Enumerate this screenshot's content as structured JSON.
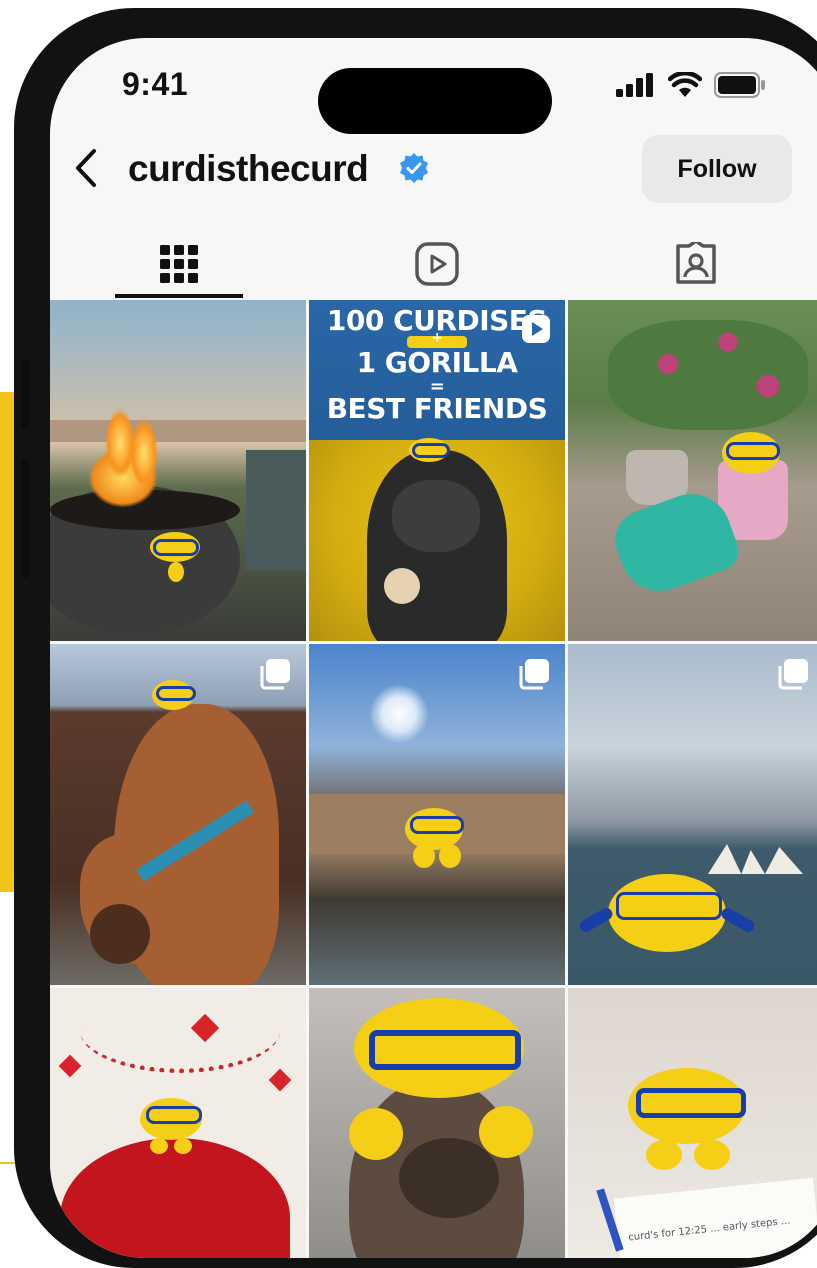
{
  "status_bar": {
    "time": "9:41"
  },
  "profile": {
    "username": "curdisthecurd",
    "verified": true
  },
  "header": {
    "follow_label": "Follow"
  },
  "tabs": [
    {
      "name": "grid-icon",
      "active": true
    },
    {
      "name": "reels-icon",
      "active": false
    },
    {
      "name": "tagged-icon",
      "active": false
    }
  ],
  "posts": [
    {
      "subject": "fire pit at sunset",
      "type": "photo"
    },
    {
      "subject": "gorilla with plush toys",
      "type": "reel",
      "overlay": {
        "line1": "100 CURDISES",
        "plus": "+",
        "line2": "1 GORILLA",
        "equals": "=",
        "line3": "BEST FRIENDS"
      }
    },
    {
      "subject": "garden with watering can and gloves",
      "type": "photo"
    },
    {
      "subject": "horse with plush on head",
      "type": "carousel"
    },
    {
      "subject": "wooden bridge in park",
      "type": "carousel"
    },
    {
      "subject": "harbour view with opera house",
      "type": "carousel"
    },
    {
      "subject": "valentine heart pillow",
      "type": "photo"
    },
    {
      "subject": "dog with plush on head",
      "type": "photo"
    },
    {
      "subject": "plush with pen and notepad",
      "type": "photo",
      "note_text": "curd's for 12:25 ... early steps ..."
    }
  ],
  "colors": {
    "accent_yellow": "#f2c318",
    "verified_blue": "#3897f0",
    "plush_yellow": "#f4cf16",
    "plush_blue": "#1a3ea8"
  }
}
